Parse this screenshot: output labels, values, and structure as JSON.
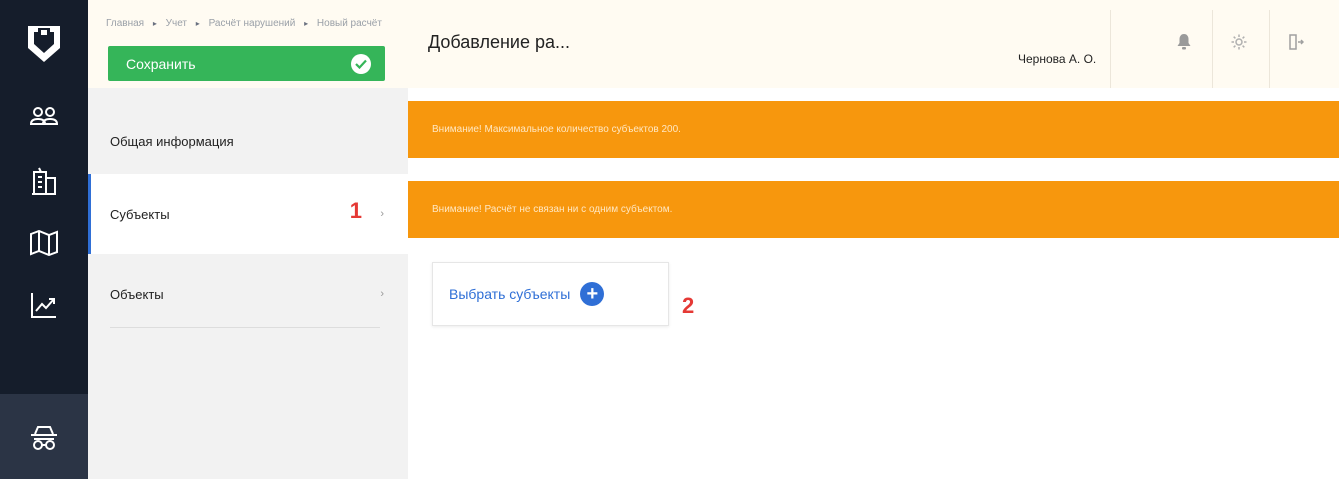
{
  "rail": {
    "logo_icon": "shield-logo-icon",
    "items": [
      {
        "icon": "users-icon"
      },
      {
        "icon": "building-icon"
      },
      {
        "icon": "map-icon"
      },
      {
        "icon": "chart-trend-icon"
      },
      {
        "icon": "car-icon",
        "active": true
      }
    ]
  },
  "header": {
    "breadcrumbs": [
      "Главная",
      "Учет",
      "Расчёт нарушений",
      "Новый расчёт"
    ],
    "breadcrumb_separator": "▸",
    "save_label": "Сохранить",
    "title": "Добавление ра...",
    "user_name": "Чернова А. О.",
    "icons": [
      "bell-icon",
      "gear-icon",
      "logout-icon"
    ]
  },
  "subnav": {
    "items": [
      {
        "label": "Общая информация"
      },
      {
        "label": "Субъекты",
        "active": true,
        "marker": "1",
        "chevron": "›"
      },
      {
        "label": "Объекты",
        "chevron": "›"
      }
    ]
  },
  "main": {
    "alerts": [
      "Внимание! Максимальное количество субъектов 200.",
      "Внимание! Расчёт не связан ни с одним субъектом."
    ],
    "pick_subjects_label": "Выбрать субъекты",
    "plus_glyph": "+",
    "marker": "2"
  },
  "colors": {
    "rail_bg": "#151d2b",
    "rail_active": "#2b3445",
    "save_green": "#35b559",
    "alert_orange": "#f7970d",
    "accent_blue": "#2f6fd6",
    "marker_red": "#e53935"
  }
}
